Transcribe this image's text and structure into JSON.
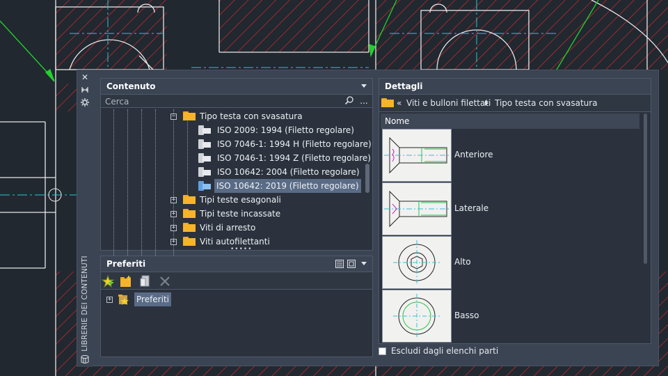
{
  "palette": {
    "side_label": "LIBRERIE DEI CONTENUTI",
    "content_panel": {
      "title": "Contenuto",
      "search_placeholder": "Cerca",
      "more_label": "...",
      "tree": [
        {
          "label": "Tipo testa con svasatura",
          "icon": "folder-icon",
          "expanded": true
        },
        {
          "label": "ISO 2009: 1994 (Filetto regolare)",
          "icon": "bolt-icon"
        },
        {
          "label": "ISO 7046-1: 1994 H  (Filetto regolare)",
          "icon": "bolt-icon"
        },
        {
          "label": "ISO 7046-1: 1994 Z  (Filetto regolare)",
          "icon": "bolt-icon"
        },
        {
          "label": "ISO 10642: 2004 (Filetto regolare)",
          "icon": "bolt-icon"
        },
        {
          "label": "ISO 10642: 2019 (Filetto regolare)",
          "icon": "bolt-icon",
          "selected": true
        },
        {
          "label": "Tipi teste esagonali",
          "icon": "folder-icon"
        },
        {
          "label": "Tipi teste incassate",
          "icon": "folder-icon"
        },
        {
          "label": "Viti di arresto",
          "icon": "folder-icon"
        },
        {
          "label": "Viti autofilettanti",
          "icon": "folder-icon"
        }
      ]
    },
    "favorites_panel": {
      "title": "Preferiti",
      "tree": [
        {
          "label": "Preferiti",
          "icon": "favorites-folder-icon"
        }
      ]
    },
    "details_panel": {
      "title": "Dettagli",
      "breadcrumb": [
        "«",
        "Viti e bulloni filettati",
        "Tipo testa con svasatura"
      ],
      "column_header": "Nome",
      "items": [
        {
          "label": "Anteriore"
        },
        {
          "label": "Laterale"
        },
        {
          "label": "Alto"
        },
        {
          "label": "Basso"
        }
      ],
      "exclude_label": "Escludi dagli elenchi parti"
    }
  }
}
